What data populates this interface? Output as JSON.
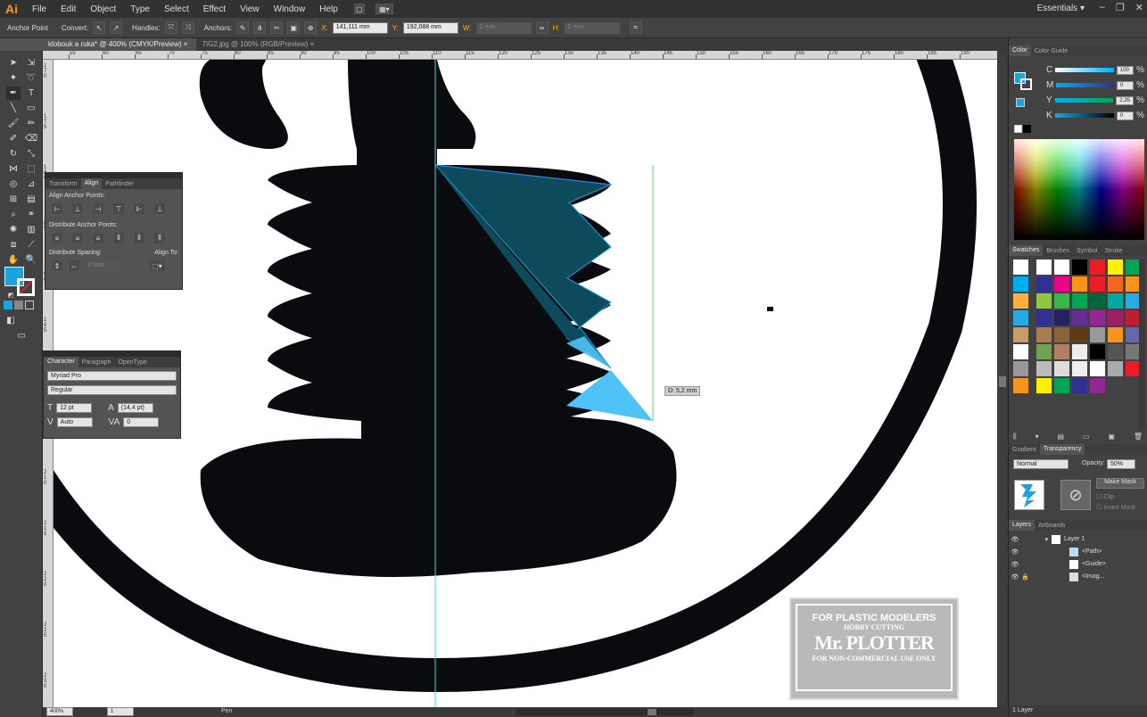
{
  "app": {
    "logo": "Ai",
    "workspace": "Essentials",
    "window_controls": [
      "–",
      "❐",
      "✕"
    ]
  },
  "menu": [
    "File",
    "Edit",
    "Object",
    "Type",
    "Select",
    "Effect",
    "View",
    "Window",
    "Help"
  ],
  "control_bar": {
    "tool": "Anchor Point",
    "convert": "Convert:",
    "handles": "Handles:",
    "anchors": "Anchors:",
    "x_label": "X:",
    "x_value": "141,111 mm",
    "y_label": "Y:",
    "y_value": "192,088 mm",
    "w_label": "W:",
    "w_value": "0 mm",
    "h_label": "H:",
    "h_value": "0 mm"
  },
  "tabs": [
    {
      "label": "klobouk a ruka* @ 400% (CMYK/Preview)",
      "close": "×"
    },
    {
      "label": "7IG2.jpg @ 100% (RGB/Preview)",
      "close": "×"
    }
  ],
  "ruler_top": [
    "55",
    "60",
    "65",
    "70",
    "75",
    "80",
    "85",
    "90",
    "95",
    "100",
    "105",
    "110",
    "115",
    "120",
    "125",
    "130",
    "135",
    "140",
    "145",
    "150",
    "155",
    "160",
    "165",
    "170",
    "175",
    "180",
    "185",
    "190"
  ],
  "ruler_left": [
    "1 7 0",
    "1 7 5",
    "1 8 0",
    "1 8 5",
    "1 9 0",
    "1 9 5",
    "2 0 0",
    "2 0 5",
    "2 1 0",
    "2 1 5",
    "2 2 0",
    "2 2 5",
    "2 3 0"
  ],
  "canvas": {
    "distance_tooltip": "D: 5,2 mm"
  },
  "watermark": {
    "line1": "FOR PLASTIC MODELERS",
    "line2": "HOBBY CUTTING",
    "line3": "Mr. PLOTTER",
    "line4": "FOR NON-COMMERCIAL USE ONLY"
  },
  "align_panel": {
    "tabs": [
      "Transform",
      "Align",
      "Pathfinder"
    ],
    "align_anchor": "Align Anchor Points:",
    "distribute_anchor": "Distribute Anchor Points:",
    "distribute_spacing": "Distribute Spacing:",
    "align_to": "Align To:",
    "spacing_value": "0 mm"
  },
  "character_panel": {
    "tabs": [
      "Character",
      "Paragraph",
      "OpenType"
    ],
    "font": "Myriad Pro",
    "style": "Regular",
    "size": "12 pt",
    "leading": "(14,4 pt)",
    "kerning": "Auto",
    "tracking": "0"
  },
  "color_panel": {
    "tabs": [
      "Color",
      "Color Guide"
    ],
    "channels": [
      {
        "label": "C",
        "value": "100",
        "pct": "%"
      },
      {
        "label": "M",
        "value": "0",
        "pct": "%"
      },
      {
        "label": "Y",
        "value": "2,35",
        "pct": "%"
      },
      {
        "label": "K",
        "value": "0",
        "pct": "%"
      }
    ]
  },
  "swatches_panel": {
    "tabs": [
      "Swatches",
      "Brushes",
      "Symbol",
      "Stroke"
    ]
  },
  "transparency_panel": {
    "tabs": [
      "Gradient",
      "Transparency"
    ],
    "blend": "Normal",
    "opacity_label": "Opacity:",
    "opacity": "50%",
    "make_mask": "Make Mask",
    "clip": "Clip",
    "invert": "Invert Mask"
  },
  "layers_panel": {
    "tabs": [
      "Layers",
      "Artboards"
    ],
    "rows": [
      "Layer 1",
      "<Path>",
      "<Guide>",
      "<Imag..."
    ],
    "footer": "1 Layer"
  },
  "status": {
    "zoom": "400%",
    "artboard": "1",
    "tool": "Pen"
  },
  "colors": {
    "fill": "#1aa3e0",
    "selection": "#0d4b5c",
    "accent": "#4fc3f7"
  }
}
